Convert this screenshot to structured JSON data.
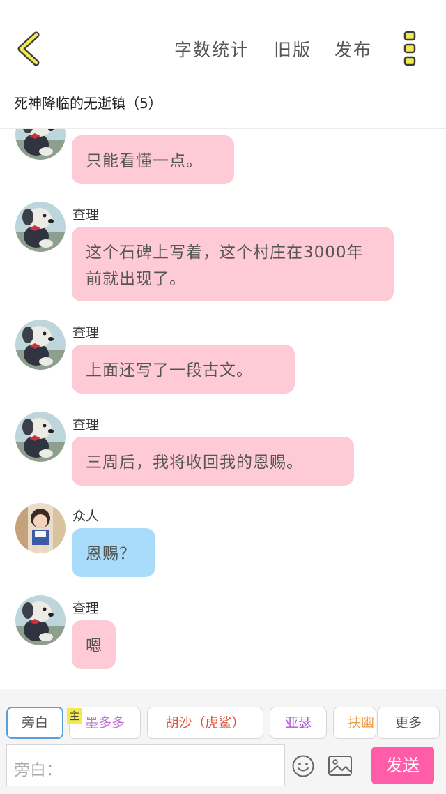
{
  "header": {
    "stats_label": "字数统计",
    "old_version_label": "旧版",
    "publish_label": "发布",
    "story_title": "死神降临的无逝镇（5）"
  },
  "messages": [
    {
      "sender": "",
      "text": "只能看懂一点。",
      "avatar": "dog-avatar",
      "bubble_color": "#fecad6"
    },
    {
      "sender": "查理",
      "text": "这个石碑上写着，这个村庄在3000年前就出现了。",
      "avatar": "dog-avatar",
      "bubble_color": "#fecad6"
    },
    {
      "sender": "查理",
      "text": "上面还写了一段古文。",
      "avatar": "dog-avatar",
      "bubble_color": "#fecad6"
    },
    {
      "sender": "查理",
      "text": "三周后，我将收回我的恩赐。",
      "avatar": "dog-avatar",
      "bubble_color": "#fecad6"
    },
    {
      "sender": "众人",
      "text": "恩赐？",
      "avatar": "girl-avatar",
      "bubble_color": "#a9dcfb"
    },
    {
      "sender": "查理",
      "text": "嗯",
      "avatar": "dog-avatar",
      "bubble_color": "#fecad6"
    }
  ],
  "roles": {
    "narration": "旁白",
    "main_badge": "主",
    "moduo": "墨多多",
    "husha": "胡沙（虎鲨）",
    "arthur": "亚瑟",
    "fuyou": "扶幽",
    "more": "更多"
  },
  "input": {
    "placeholder": "旁白："
  },
  "send_label": "发送",
  "colors": {
    "pink_bubble": "#fecad6",
    "blue_bubble": "#a9dcfb",
    "send_button": "#ff5da8",
    "selected_role_border": "#5a9fe0",
    "accent_yellow": "#f3ea4f"
  }
}
